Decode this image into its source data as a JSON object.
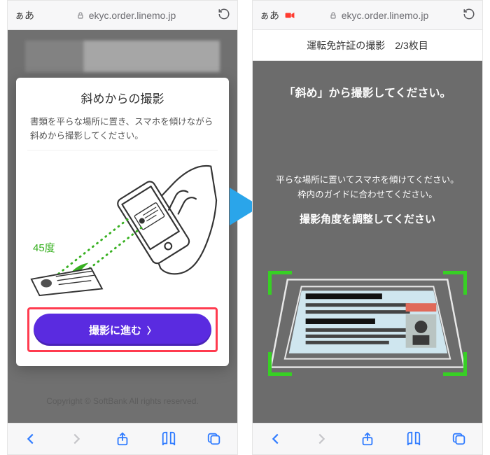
{
  "url": "ekyc.order.linemo.jp",
  "aa_label": "ぁあ",
  "left": {
    "card_title": "斜めからの撮影",
    "card_desc": "書類を平らな場所に置き、スマホを傾けながら斜めから撮影してください。",
    "angle_label": "45度",
    "cta_label": "撮影に進む",
    "copyright": "Copyright © SoftBank All rights reserved."
  },
  "right": {
    "header_title": "運転免許証の撮影",
    "header_step": "2/3枚目",
    "line1": "「斜め」から撮影してください。",
    "line2a": "平らな場所に置いてスマホを傾けてください。",
    "line2b": "枠内のガイドに合わせてください。",
    "line3": "撮影角度を調整してください"
  }
}
